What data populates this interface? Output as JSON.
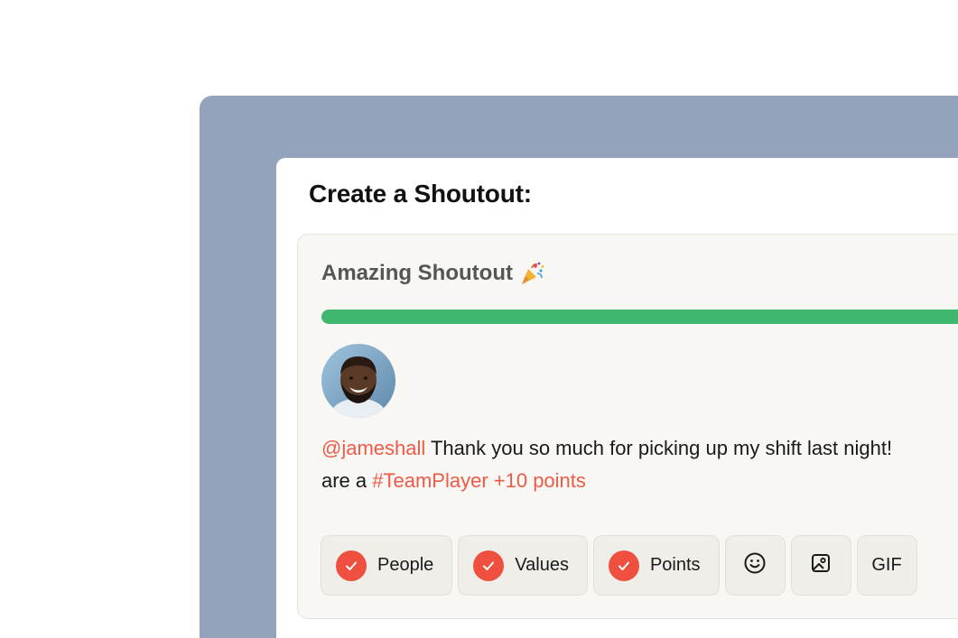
{
  "card": {
    "title": "Create a Shoutout:"
  },
  "shoutout": {
    "title": "Amazing Shoutout",
    "title_icon": "party-popper-icon",
    "progress_fraction": 1.0,
    "progress_color": "#41b66f",
    "message": {
      "mention": "@jameshall",
      "line1_text": " Thank you so much for picking up my shift last night!",
      "line2_prefix": "are a ",
      "hashtag": "#TeamPlayer",
      "points": " +10 points"
    }
  },
  "toolbar": {
    "people_label": "People",
    "values_label": "Values",
    "points_label": "Points",
    "gif_label": "GIF",
    "emoji_icon": "smiley-icon",
    "image_icon": "image-icon",
    "check_icon": "check-icon"
  },
  "colors": {
    "accent": "#ee5a48",
    "check": "#ef4f3e",
    "backdrop": "#93a3bc"
  }
}
